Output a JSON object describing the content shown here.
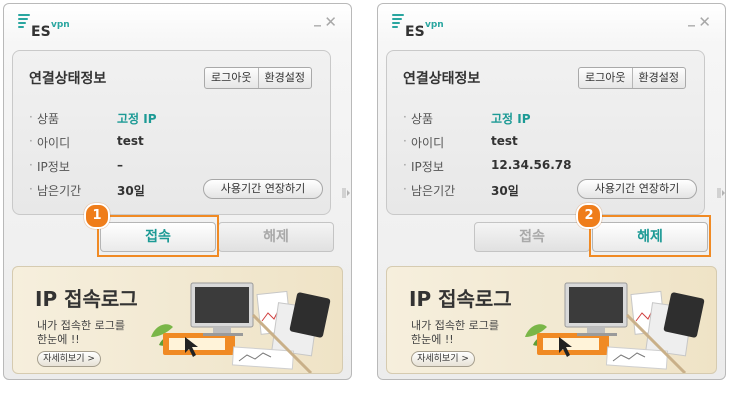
{
  "windows": [
    {
      "app": {
        "logo_main": "ES",
        "logo_sub": "vpn"
      },
      "panel": {
        "title": "연결상태정보",
        "buttons": [
          "로그아웃",
          "환경설정"
        ],
        "rows": [
          {
            "label": "상품",
            "value": "고정 IP"
          },
          {
            "label": "아이디",
            "value": "test"
          },
          {
            "label": "IP정보",
            "value": "–"
          },
          {
            "label": "남은기간",
            "value": "30일"
          }
        ],
        "extend_label": "사용기간 연장하기"
      },
      "actions": {
        "connect": "접속",
        "disconnect": "해제",
        "active": "connect"
      },
      "step_badge": "1",
      "banner": {
        "title": "IP 접속로그",
        "sub1": "내가 접속한 로그를",
        "sub2": "한눈에 !!",
        "detail": "자세히보기 >"
      }
    },
    {
      "app": {
        "logo_main": "ES",
        "logo_sub": "vpn"
      },
      "panel": {
        "title": "연결상태정보",
        "buttons": [
          "로그아웃",
          "환경설정"
        ],
        "rows": [
          {
            "label": "상품",
            "value": "고정 IP"
          },
          {
            "label": "아이디",
            "value": "test"
          },
          {
            "label": "IP정보",
            "value": "12.34.56.78"
          },
          {
            "label": "남은기간",
            "value": "30일"
          }
        ],
        "extend_label": "사용기간 연장하기"
      },
      "actions": {
        "connect": "접속",
        "disconnect": "해제",
        "active": "disconnect"
      },
      "step_badge": "2",
      "banner": {
        "title": "IP 접속로그",
        "sub1": "내가 접속한 로그를",
        "sub2": "한눈에 !!",
        "detail": "자세히보기 >"
      }
    }
  ],
  "colors": {
    "accent": "#1c9a95",
    "highlight": "#f08a24",
    "badge": "#ef7d1a"
  },
  "icons": {
    "minimize": "minimize-icon",
    "close": "close-icon",
    "side_expand": "side-expand-icon"
  }
}
